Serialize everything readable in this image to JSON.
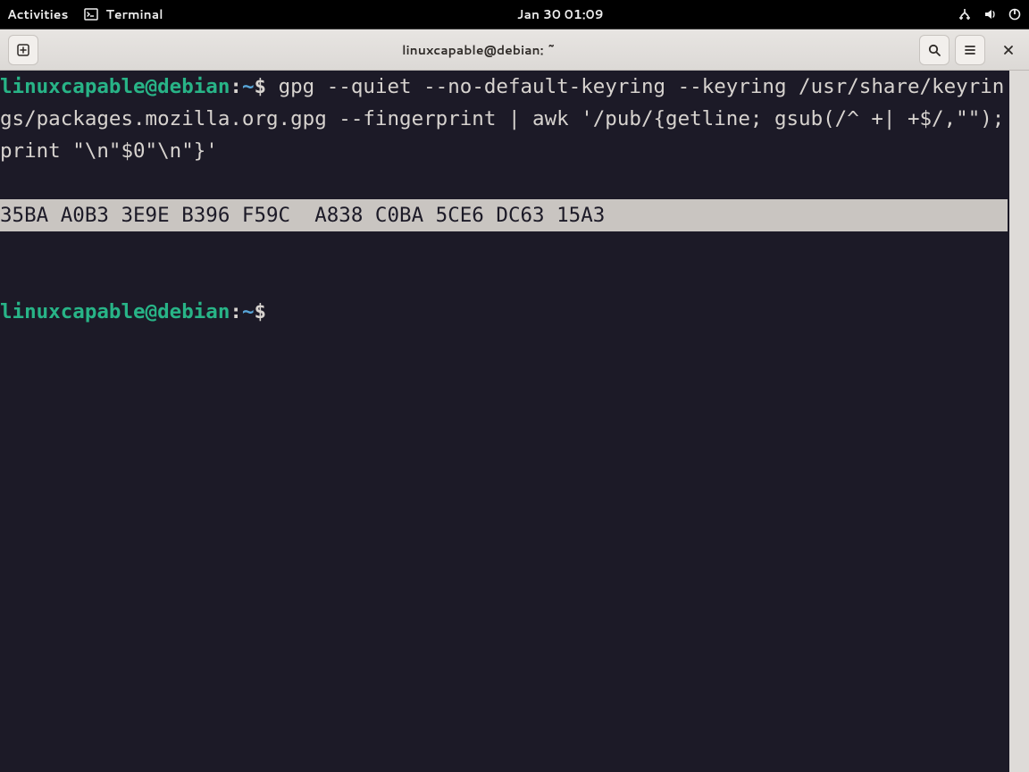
{
  "topbar": {
    "activities": "Activities",
    "app_label": "Terminal",
    "datetime": "Jan 30  01:09"
  },
  "titlebar": {
    "title": "linuxcapable@debian: ~"
  },
  "terminal": {
    "prompt_user": "linuxcapable@debian",
    "prompt_sep": ":",
    "prompt_path": "~",
    "prompt_symbol": "$",
    "command": "gpg --quiet --no-default-keyring --keyring /usr/share/keyrings/packages.mozilla.org.gpg --fingerprint | awk '/pub/{getline; gsub(/^ +| +$/,\"\"); print \"\\n\"$0\"\\n\"}'",
    "output_highlight": "35BA A0B3 3E9E B396 F59C  A838 C0BA 5CE6 DC63 15A3"
  }
}
